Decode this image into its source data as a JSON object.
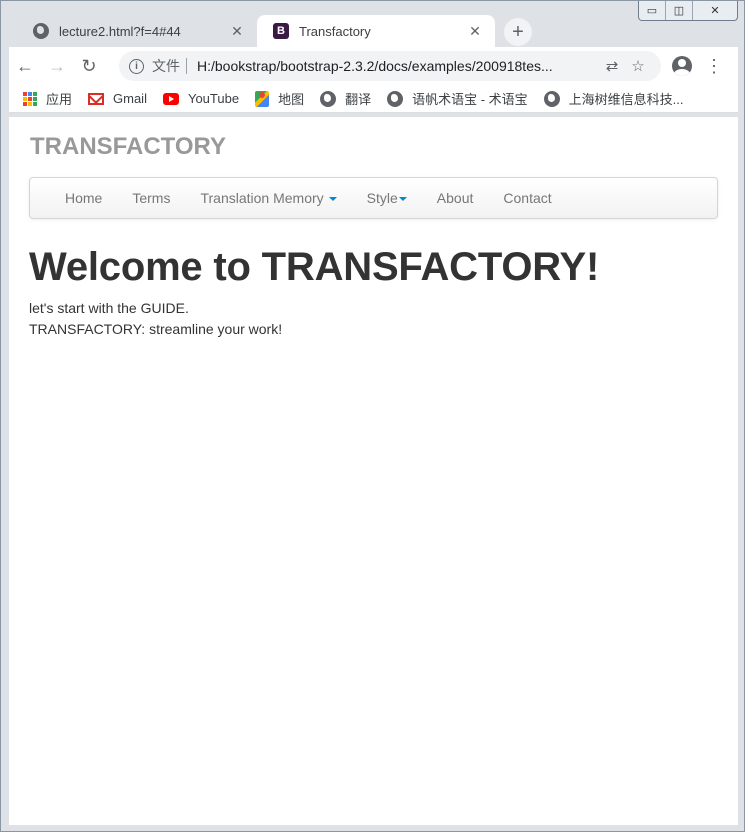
{
  "browser": {
    "tabs": [
      {
        "title": "lecture2.html?f=4#44",
        "active": false,
        "icon": "globe-icon"
      },
      {
        "title": "Transfactory",
        "active": true,
        "icon": "bootstrap-icon"
      }
    ],
    "address": {
      "scheme_label": "文件",
      "url": "H:/bookstrap/bootstrap-2.3.2/docs/examples/200918tes..."
    },
    "bookmarks": [
      {
        "label": "应用",
        "icon": "apps-icon"
      },
      {
        "label": "Gmail",
        "icon": "gmail-icon"
      },
      {
        "label": "YouTube",
        "icon": "youtube-icon"
      },
      {
        "label": "地图",
        "icon": "maps-icon"
      },
      {
        "label": "翻译",
        "icon": "globe-icon"
      },
      {
        "label": "语帆术语宝 - 术语宝",
        "icon": "globe-icon"
      },
      {
        "label": "上海树维信息科技...",
        "icon": "globe-icon"
      }
    ],
    "bootstrap_letter": "B"
  },
  "page": {
    "brand": "TRANSFACTORY",
    "nav": [
      {
        "label": "Home",
        "dropdown": false
      },
      {
        "label": "Terms",
        "dropdown": false
      },
      {
        "label": "Translation Memory",
        "dropdown": true
      },
      {
        "label": "Style",
        "dropdown": true
      },
      {
        "label": "About",
        "dropdown": false
      },
      {
        "label": "Contact",
        "dropdown": false
      }
    ],
    "heading": "Welcome to TRANSFACTORY!",
    "lines": [
      "let's start with the GUIDE.",
      "TRANSFACTORY: streamline your work!"
    ]
  },
  "colors": {
    "brand_gray": "#999999",
    "nav_text": "#777777",
    "caret_blue": "#0088cc",
    "heading": "#333333"
  }
}
